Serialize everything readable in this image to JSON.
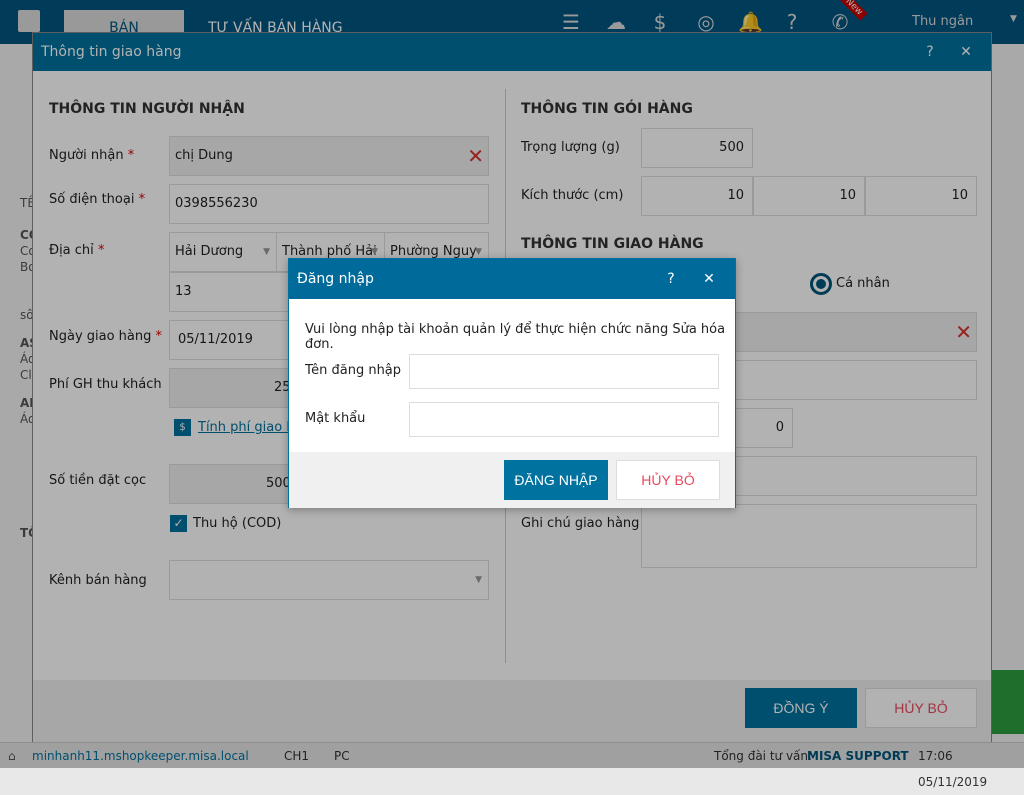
{
  "app": {
    "tabs": [
      "BÁN HÀNG",
      "TƯ VẤN BÁN HÀNG"
    ],
    "user": "Thu ngân",
    "new_badge": "New",
    "icons": [
      "menu-icon",
      "cloud-sync-icon",
      "money-icon",
      "swirl-icon",
      "bell-icon",
      "help-icon",
      "phone-support-icon"
    ]
  },
  "side": {
    "fragments": [
      "TÊ",
      "CO",
      "Co",
      "Bo",
      "sô",
      "AS",
      "Ád",
      "Cl",
      "AF",
      "Ád",
      "TỔ"
    ]
  },
  "status": {
    "domain": "minhanh11.mshopkeeper.misa.local",
    "branch": "CH1",
    "device": "PC",
    "hotline_label": "Tổng đài tư vấn:",
    "hotline": "MISA SUPPORT",
    "time": "17:06 05/11/2019"
  },
  "dialog": {
    "title": "Thông tin giao hàng",
    "help": "?",
    "close": "✕",
    "left": {
      "heading": "THÔNG TIN NGƯỜI NHẬN",
      "recipient_label": "Người nhận",
      "recipient": "chị Dung",
      "phone_label": "Số điện thoại",
      "phone": "0398556230",
      "address_label": "Địa chỉ",
      "province": "Hải Dương",
      "district": "Thành phố Hải",
      "ward": "Phường Nguy",
      "street": "13",
      "date_label": "Ngày giao hàng",
      "date": "05/11/2019",
      "fee_label": "Phí GH thu khách",
      "fee": "25",
      "calc_link": "Tính phí giao hà",
      "deposit_label": "Số tiền đặt cọc",
      "deposit": "500",
      "cod_label": "Thu hộ (COD)",
      "cod_checked": true,
      "channel_label": "Kênh bán hàng",
      "channel": ""
    },
    "right": {
      "heading": "THÔNG TIN GÓI HÀNG",
      "weight_label": "Trọng lượng (g)",
      "weight": "500",
      "size_label": "Kích thước (cm)",
      "size": [
        "10",
        "10",
        "10"
      ],
      "ship_heading": "THÔNG TIN GIAO HÀNG",
      "radio_label": "Cá nhân",
      "cod_fee": "0",
      "note_label": "Ghi chú giao hàng"
    },
    "ok": "ĐỒNG Ý",
    "cancel": "HỦY BỎ"
  },
  "login": {
    "title": "Đăng nhập",
    "help": "?",
    "close": "✕",
    "message": "Vui lòng nhập tài khoản quản lý để thực hiện chức năng Sửa hóa đơn.",
    "username_label": "Tên đăng nhập",
    "username": "",
    "password_label": "Mật khẩu",
    "password": "",
    "submit": "ĐĂNG NHẬP",
    "cancel": "HỦY BỎ"
  },
  "colors": {
    "primary": "#00729f",
    "danger": "#d9312f"
  }
}
